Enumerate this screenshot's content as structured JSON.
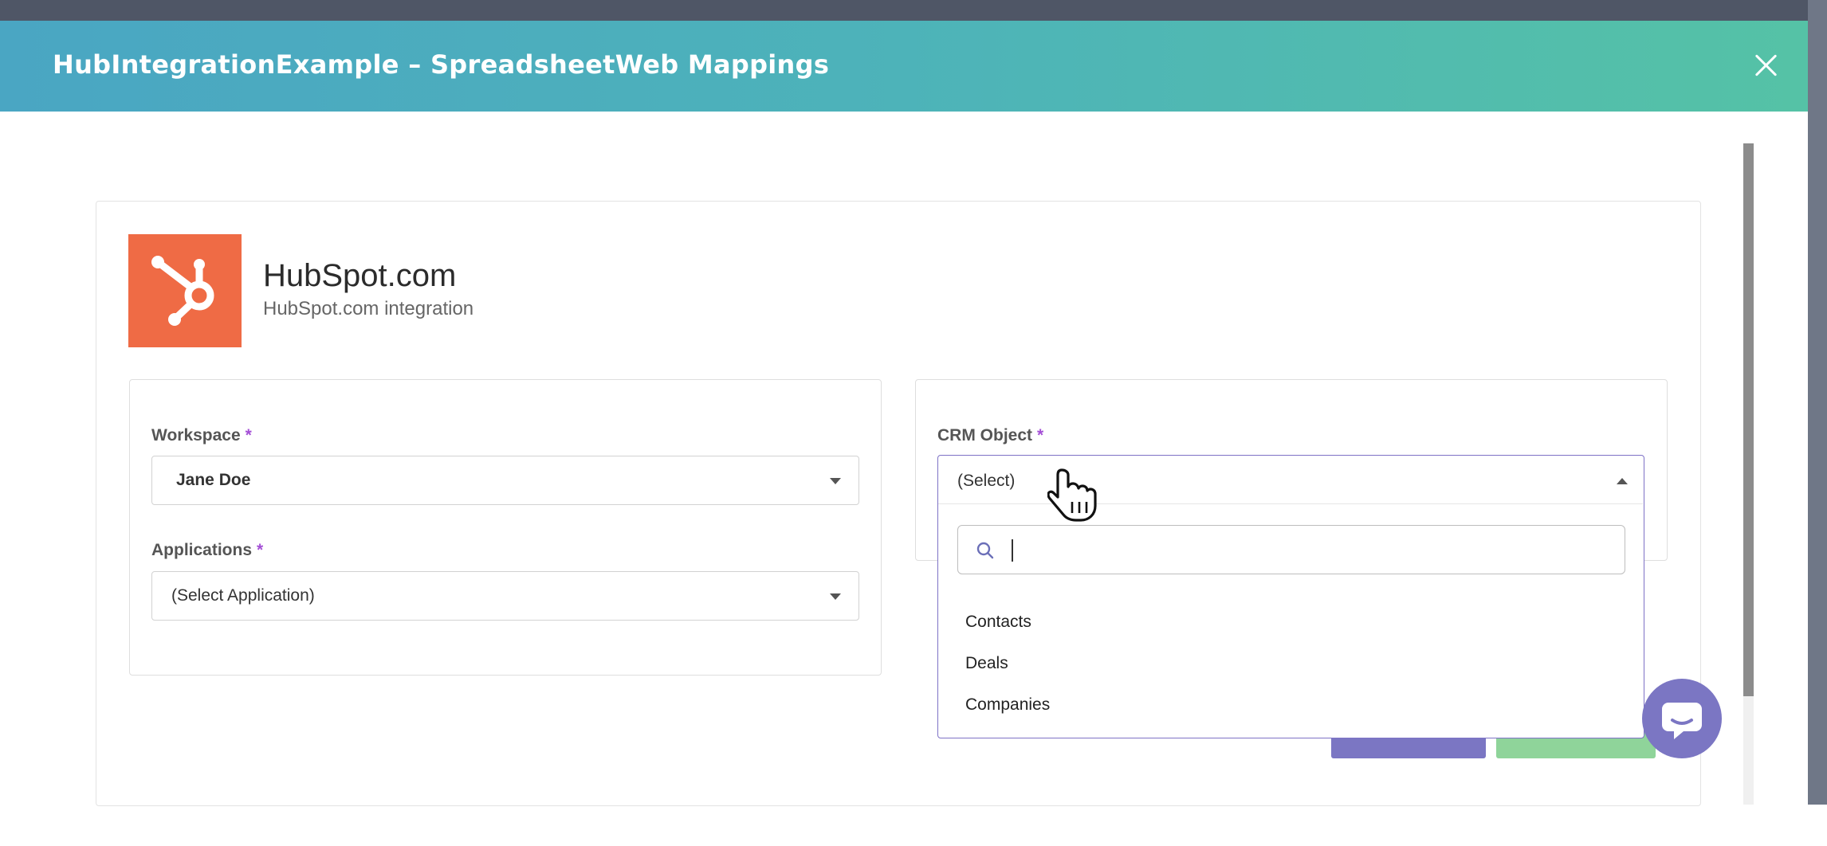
{
  "modal": {
    "title": "HubIntegrationExample – SpreadsheetWeb Mappings"
  },
  "brand": {
    "name": "HubSpot.com",
    "subtitle": "HubSpot.com integration",
    "logo_color": "#ef6b45",
    "logo_icon": "hubspot-sprocket-icon"
  },
  "workspace": {
    "label": "Workspace",
    "required_mark": "*",
    "value": "Jane Doe"
  },
  "applications": {
    "label": "Applications",
    "required_mark": "*",
    "value": "(Select Application)"
  },
  "crm_object": {
    "label": "CRM Object",
    "required_mark": "*",
    "value": "(Select)",
    "search_value": "",
    "options": [
      "Contacts",
      "Deals",
      "Companies"
    ]
  },
  "colors": {
    "header_gradient_start": "#4aa6c3",
    "header_gradient_end": "#55c2a6",
    "accent_purple": "#7b76c3",
    "required_star": "#a44fd6",
    "success_green": "#8fd49a"
  },
  "icons": {
    "close": "close-icon",
    "search": "search-icon",
    "chat": "chat-icon",
    "cursor": "hand-pointer-cursor"
  }
}
